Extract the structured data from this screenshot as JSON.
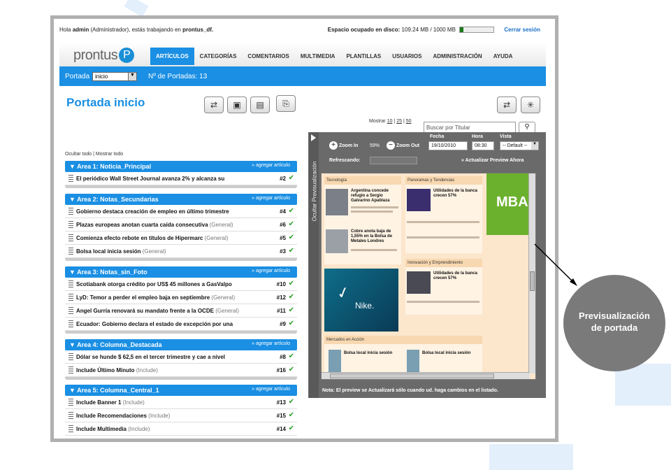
{
  "topbar": {
    "greeting_prefix": "Hola",
    "user": "admin",
    "role": "(Administrador), estás trabajando en",
    "site": "prontus_df.",
    "disk_label": "Espacio ocupado en disco:",
    "disk_value": "109.24 MB / 1000 MB",
    "disk_fraction": 0.11,
    "disk_percent": "11%",
    "logout": "Cerrar sesión"
  },
  "logo": {
    "text": "prontus",
    "mark": "P"
  },
  "tabs": [
    "ARTÍCULOS",
    "CATEGORÍAS",
    "COMENTARIOS",
    "MULTIMEDIA",
    "PLANTILLAS",
    "USUARIOS",
    "ADMINISTRACIÓN",
    "AYUDA"
  ],
  "bluebar": {
    "portada_label": "Portada",
    "portada_value": "inicio",
    "count_label": "Nº de Portadas: 13"
  },
  "page_title": "Portada inicio",
  "toggle": {
    "hide": "Ocultar todo",
    "show": "Mostrar todo"
  },
  "search": {
    "show_label": "Mostrar",
    "opt1": "10",
    "opt2": "25",
    "opt3": "50",
    "placeholder": "Buscar por Titular"
  },
  "areas": [
    {
      "title": "Area 1: Noticia_Principal",
      "add": "» agregar artículo",
      "rows": [
        {
          "text": "El periódico Wall Street Journal avanza 2% y alcanza su",
          "tag": "",
          "num": "#2"
        }
      ]
    },
    {
      "title": "Area 2: Notas_Secundarias",
      "add": "» agregar artículo",
      "rows": [
        {
          "text": "Gobierno destaca creación de empleo en último trimestre",
          "tag": "",
          "num": "#4"
        },
        {
          "text": "Plazas europeas anotan cuarta caída consecutiva",
          "tag": "(General)",
          "num": "#6"
        },
        {
          "text": "Comienza efecto rebote en títulos de Hipermarc",
          "tag": "(General)",
          "num": "#5"
        },
        {
          "text": "Bolsa local inicia sesión",
          "tag": "(General)",
          "num": "#3"
        }
      ]
    },
    {
      "title": "Area 3: Notas_sin_Foto",
      "add": "» agregar artículo",
      "rows": [
        {
          "text": "Scotiabank otorga crédito por US$ 45 millones a GasValpo",
          "tag": "",
          "num": "#10"
        },
        {
          "text": "LyD: Temor a perder el empleo baja en septiembre",
          "tag": "(General)",
          "num": "#12"
        },
        {
          "text": "Angel Gurría renovará su mandato frente a la OCDE",
          "tag": "(General)",
          "num": "#11"
        },
        {
          "text": "Ecuador: Gobierno declara el estado de excepción por una",
          "tag": "",
          "num": "#9"
        }
      ]
    },
    {
      "title": "Area 4: Columna_Destacada",
      "add": "» agregar artículo",
      "rows": [
        {
          "text": "Dólar se hunde $ 62,5 en el tercer trimestre y cae a nivel",
          "tag": "",
          "num": "#8"
        },
        {
          "text": "Include Último Minuto",
          "tag": "(Include)",
          "num": "#16"
        }
      ]
    },
    {
      "title": "Area 5: Columna_Central_1",
      "add": "» agregar artículo",
      "rows": [
        {
          "text": "Include Banner 1",
          "tag": "(Include)",
          "num": "#13"
        },
        {
          "text": "Include Recomendaciones",
          "tag": "(Include)",
          "num": "#15"
        },
        {
          "text": "Include Multimedia",
          "tag": "(Include)",
          "num": "#14"
        }
      ]
    }
  ],
  "panel": {
    "vertical_tab": "Ocultar Previsualización",
    "zoom_in": "Zoom In",
    "zoom_pct": "59%",
    "zoom_out": "Zoom Out",
    "fecha_label": "Fecha",
    "fecha_value": "19/10/2010",
    "hora_label": "Hora",
    "hora_value": "08:30",
    "vista_label": "Vista",
    "vista_value": "-- Default --",
    "refresh_label": "Refrescando:",
    "update_link": "» Actualizar Preview Ahora",
    "note": "Nota: El preview se Actualizará sólo cuando ud. haga cambios en el listado."
  },
  "preview": {
    "tecnologia": "Tecnología",
    "panoramas": "Panoramas y Tendencias",
    "innovacion": "Innovación y Emprendimiento",
    "mercados": "Mercados en Acción",
    "item1": "Argentina concede refugio a Sergio Galvarino Apablaza",
    "item2": "Utilidades de la banca crecen 57%",
    "item3": "Cobre anota baja de 1,55% en la Bolsa de Metales Londres",
    "item4": "Utilidades de la banca crecen 57%",
    "item5": "Bolsa local inicia sesión",
    "item6": "Bolsa local inicia sesión",
    "mba": "MBA",
    "nike": "Nike."
  },
  "callout": {
    "line1": "Previsualización",
    "line2": "de portada"
  }
}
